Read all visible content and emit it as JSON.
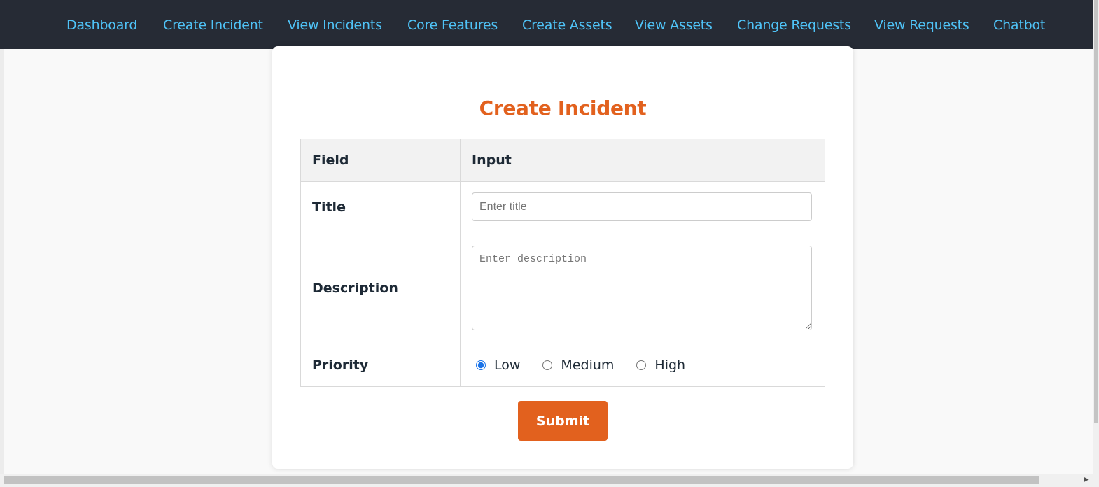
{
  "nav": {
    "items": [
      {
        "label": "Dashboard"
      },
      {
        "label": "Create Incident"
      },
      {
        "label": "View Incidents"
      },
      {
        "label": "Core Features"
      },
      {
        "label": "Create Assets"
      },
      {
        "label": "View Assets"
      },
      {
        "label": "Change Requests"
      },
      {
        "label": "View Requests"
      },
      {
        "label": "Chatbot"
      }
    ]
  },
  "form": {
    "title": "Create Incident",
    "headers": {
      "field": "Field",
      "input": "Input"
    },
    "title_field": {
      "label": "Title",
      "placeholder": "Enter title",
      "value": ""
    },
    "description_field": {
      "label": "Description",
      "placeholder": "Enter description",
      "value": ""
    },
    "priority_field": {
      "label": "Priority",
      "options": [
        {
          "label": "Low",
          "selected": true
        },
        {
          "label": "Medium",
          "selected": false
        },
        {
          "label": "High",
          "selected": false
        }
      ]
    },
    "submit_label": "Submit"
  },
  "colors": {
    "navbar_bg": "#262b35",
    "nav_link": "#4fc3f7",
    "accent": "#e2611e"
  },
  "icons": {
    "scroll_right": "scroll-right-arrow-icon"
  }
}
